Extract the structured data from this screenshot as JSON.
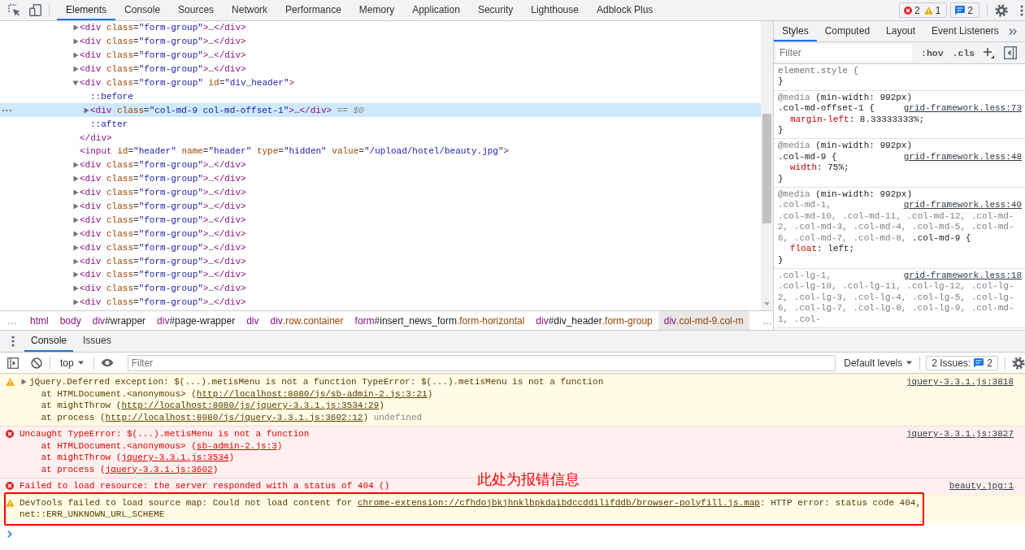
{
  "toolbar": {
    "tabs": [
      {
        "label": "Elements",
        "selected": true
      },
      {
        "label": "Console",
        "selected": false
      },
      {
        "label": "Sources",
        "selected": false
      },
      {
        "label": "Network",
        "selected": false
      },
      {
        "label": "Performance",
        "selected": false
      },
      {
        "label": "Memory",
        "selected": false
      },
      {
        "label": "Application",
        "selected": false
      },
      {
        "label": "Security",
        "selected": false
      },
      {
        "label": "Lighthouse",
        "selected": false
      },
      {
        "label": "Adblock Plus",
        "selected": false
      }
    ],
    "error_count": "2",
    "warning_count": "1",
    "message_count": "2"
  },
  "elements": {
    "dom_tree": [
      {
        "kind": "element",
        "expanded": false,
        "selected": false,
        "tokens": [
          {
            "kind": "tag",
            "text": "<div"
          },
          {
            "kind": "attr-name",
            "text": " class"
          },
          {
            "kind": "punct",
            "text": "="
          },
          {
            "kind": "attr-value",
            "text": "\"form-group\""
          },
          {
            "kind": "tag",
            "text": ">"
          },
          {
            "kind": "plain",
            "text": "…"
          },
          {
            "kind": "tag",
            "text": "</div>"
          }
        ]
      },
      {
        "kind": "element",
        "expanded": false,
        "selected": false,
        "tokens": [
          {
            "kind": "tag",
            "text": "<div"
          },
          {
            "kind": "attr-name",
            "text": " class"
          },
          {
            "kind": "punct",
            "text": "="
          },
          {
            "kind": "attr-value",
            "text": "\"form-group\""
          },
          {
            "kind": "tag",
            "text": ">"
          },
          {
            "kind": "plain",
            "text": "…"
          },
          {
            "kind": "tag",
            "text": "</div>"
          }
        ]
      },
      {
        "kind": "element",
        "expanded": false,
        "selected": false,
        "tokens": [
          {
            "kind": "tag",
            "text": "<div"
          },
          {
            "kind": "attr-name",
            "text": " class"
          },
          {
            "kind": "punct",
            "text": "="
          },
          {
            "kind": "attr-value",
            "text": "\"form-group\""
          },
          {
            "kind": "tag",
            "text": ">"
          },
          {
            "kind": "plain",
            "text": "…"
          },
          {
            "kind": "tag",
            "text": "</div>"
          }
        ]
      },
      {
        "kind": "element",
        "expanded": false,
        "selected": false,
        "tokens": [
          {
            "kind": "tag",
            "text": "<div"
          },
          {
            "kind": "attr-name",
            "text": " class"
          },
          {
            "kind": "punct",
            "text": "="
          },
          {
            "kind": "attr-value",
            "text": "\"form-group\""
          },
          {
            "kind": "tag",
            "text": ">"
          },
          {
            "kind": "plain",
            "text": "…"
          },
          {
            "kind": "tag",
            "text": "</div>"
          }
        ]
      },
      {
        "kind": "element",
        "expanded": true,
        "selected": false,
        "tokens": [
          {
            "kind": "tag",
            "text": "<div"
          },
          {
            "kind": "attr-name",
            "text": " class"
          },
          {
            "kind": "punct",
            "text": "="
          },
          {
            "kind": "attr-value",
            "text": "\"form-group\""
          },
          {
            "kind": "attr-name",
            "text": " id"
          },
          {
            "kind": "punct",
            "text": "="
          },
          {
            "kind": "attr-value",
            "text": "\"div_header\""
          },
          {
            "kind": "tag",
            "text": ">"
          }
        ],
        "children": [
          {
            "kind": "pseudo",
            "selected": false,
            "tokens": [
              {
                "kind": "pseudo",
                "text": "::before"
              }
            ]
          },
          {
            "kind": "element",
            "expanded": false,
            "selected": true,
            "tokens": [
              {
                "kind": "tag",
                "text": "<div"
              },
              {
                "kind": "attr-name",
                "text": " class"
              },
              {
                "kind": "punct",
                "text": "="
              },
              {
                "kind": "attr-value",
                "text": "\"col-md-9 col-md-offset-1\""
              },
              {
                "kind": "tag",
                "text": ">"
              },
              {
                "kind": "plain",
                "text": "…"
              },
              {
                "kind": "tag",
                "text": "</div>"
              },
              {
                "kind": "hint",
                "text": " == $0"
              }
            ]
          },
          {
            "kind": "pseudo",
            "selected": false,
            "tokens": [
              {
                "kind": "pseudo",
                "text": "::after"
              }
            ]
          }
        ],
        "closing_tokens": [
          {
            "kind": "tag",
            "text": "</div>"
          }
        ]
      },
      {
        "kind": "void",
        "selected": false,
        "tokens": [
          {
            "kind": "tag",
            "text": "<input"
          },
          {
            "kind": "attr-name",
            "text": " id"
          },
          {
            "kind": "punct",
            "text": "="
          },
          {
            "kind": "attr-value",
            "text": "\"header\""
          },
          {
            "kind": "attr-name",
            "text": " name"
          },
          {
            "kind": "punct",
            "text": "="
          },
          {
            "kind": "attr-value",
            "text": "\"header\""
          },
          {
            "kind": "attr-name",
            "text": " type"
          },
          {
            "kind": "punct",
            "text": "="
          },
          {
            "kind": "attr-value",
            "text": "\"hidden\""
          },
          {
            "kind": "attr-name",
            "text": " value"
          },
          {
            "kind": "punct",
            "text": "="
          },
          {
            "kind": "attr-value",
            "text": "\"/upload/hotel/beauty.jpg\""
          },
          {
            "kind": "tag",
            "text": ">"
          }
        ]
      },
      {
        "kind": "element",
        "expanded": false,
        "selected": false,
        "tokens": [
          {
            "kind": "tag",
            "text": "<div"
          },
          {
            "kind": "attr-name",
            "text": " class"
          },
          {
            "kind": "punct",
            "text": "="
          },
          {
            "kind": "attr-value",
            "text": "\"form-group\""
          },
          {
            "kind": "tag",
            "text": ">"
          },
          {
            "kind": "plain",
            "text": "…"
          },
          {
            "kind": "tag",
            "text": "</div>"
          }
        ]
      },
      {
        "kind": "element",
        "expanded": false,
        "selected": false,
        "tokens": [
          {
            "kind": "tag",
            "text": "<div"
          },
          {
            "kind": "attr-name",
            "text": " class"
          },
          {
            "kind": "punct",
            "text": "="
          },
          {
            "kind": "attr-value",
            "text": "\"form-group\""
          },
          {
            "kind": "tag",
            "text": ">"
          },
          {
            "kind": "plain",
            "text": "…"
          },
          {
            "kind": "tag",
            "text": "</div>"
          }
        ]
      },
      {
        "kind": "element",
        "expanded": false,
        "selected": false,
        "tokens": [
          {
            "kind": "tag",
            "text": "<div"
          },
          {
            "kind": "attr-name",
            "text": " class"
          },
          {
            "kind": "punct",
            "text": "="
          },
          {
            "kind": "attr-value",
            "text": "\"form-group\""
          },
          {
            "kind": "tag",
            "text": ">"
          },
          {
            "kind": "plain",
            "text": "…"
          },
          {
            "kind": "tag",
            "text": "</div>"
          }
        ]
      },
      {
        "kind": "element",
        "expanded": false,
        "selected": false,
        "tokens": [
          {
            "kind": "tag",
            "text": "<div"
          },
          {
            "kind": "attr-name",
            "text": " class"
          },
          {
            "kind": "punct",
            "text": "="
          },
          {
            "kind": "attr-value",
            "text": "\"form-group\""
          },
          {
            "kind": "tag",
            "text": ">"
          },
          {
            "kind": "plain",
            "text": "…"
          },
          {
            "kind": "tag",
            "text": "</div>"
          }
        ]
      },
      {
        "kind": "element",
        "expanded": false,
        "selected": false,
        "tokens": [
          {
            "kind": "tag",
            "text": "<div"
          },
          {
            "kind": "attr-name",
            "text": " class"
          },
          {
            "kind": "punct",
            "text": "="
          },
          {
            "kind": "attr-value",
            "text": "\"form-group\""
          },
          {
            "kind": "tag",
            "text": ">"
          },
          {
            "kind": "plain",
            "text": "…"
          },
          {
            "kind": "tag",
            "text": "</div>"
          }
        ]
      },
      {
        "kind": "element",
        "expanded": false,
        "selected": false,
        "tokens": [
          {
            "kind": "tag",
            "text": "<div"
          },
          {
            "kind": "attr-name",
            "text": " class"
          },
          {
            "kind": "punct",
            "text": "="
          },
          {
            "kind": "attr-value",
            "text": "\"form-group\""
          },
          {
            "kind": "tag",
            "text": ">"
          },
          {
            "kind": "plain",
            "text": "…"
          },
          {
            "kind": "tag",
            "text": "</div>"
          }
        ]
      },
      {
        "kind": "element",
        "expanded": false,
        "selected": false,
        "tokens": [
          {
            "kind": "tag",
            "text": "<div"
          },
          {
            "kind": "attr-name",
            "text": " class"
          },
          {
            "kind": "punct",
            "text": "="
          },
          {
            "kind": "attr-value",
            "text": "\"form-group\""
          },
          {
            "kind": "tag",
            "text": ">"
          },
          {
            "kind": "plain",
            "text": "…"
          },
          {
            "kind": "tag",
            "text": "</div>"
          }
        ]
      },
      {
        "kind": "element",
        "expanded": false,
        "selected": false,
        "tokens": [
          {
            "kind": "tag",
            "text": "<div"
          },
          {
            "kind": "attr-name",
            "text": " class"
          },
          {
            "kind": "punct",
            "text": "="
          },
          {
            "kind": "attr-value",
            "text": "\"form-group\""
          },
          {
            "kind": "tag",
            "text": ">"
          },
          {
            "kind": "plain",
            "text": "…"
          },
          {
            "kind": "tag",
            "text": "</div>"
          }
        ]
      },
      {
        "kind": "element",
        "expanded": false,
        "selected": false,
        "tokens": [
          {
            "kind": "tag",
            "text": "<div"
          },
          {
            "kind": "attr-name",
            "text": " class"
          },
          {
            "kind": "punct",
            "text": "="
          },
          {
            "kind": "attr-value",
            "text": "\"form-group\""
          },
          {
            "kind": "tag",
            "text": ">"
          },
          {
            "kind": "plain",
            "text": "…"
          },
          {
            "kind": "tag",
            "text": "</div>"
          }
        ]
      },
      {
        "kind": "element",
        "expanded": false,
        "selected": false,
        "tokens": [
          {
            "kind": "tag",
            "text": "<div"
          },
          {
            "kind": "attr-name",
            "text": " class"
          },
          {
            "kind": "punct",
            "text": "="
          },
          {
            "kind": "attr-value",
            "text": "\"form-group\""
          },
          {
            "kind": "tag",
            "text": ">"
          },
          {
            "kind": "plain",
            "text": "…"
          },
          {
            "kind": "tag",
            "text": "</div>"
          }
        ]
      },
      {
        "kind": "element",
        "expanded": false,
        "selected": false,
        "tokens": [
          {
            "kind": "tag",
            "text": "<div"
          },
          {
            "kind": "attr-name",
            "text": " class"
          },
          {
            "kind": "punct",
            "text": "="
          },
          {
            "kind": "attr-value",
            "text": "\"form-group\""
          },
          {
            "kind": "tag",
            "text": ">"
          },
          {
            "kind": "plain",
            "text": "…"
          },
          {
            "kind": "tag",
            "text": "</div>"
          }
        ]
      }
    ],
    "breadcrumbs": {
      "scroll_left": "…",
      "items": [
        {
          "selected": false,
          "parts": [
            {
              "kind": "name",
              "text": "html"
            }
          ]
        },
        {
          "selected": false,
          "parts": [
            {
              "kind": "name",
              "text": "body"
            }
          ]
        },
        {
          "selected": false,
          "parts": [
            {
              "kind": "name",
              "text": "div"
            },
            {
              "kind": "id",
              "text": "#wrapper"
            }
          ]
        },
        {
          "selected": false,
          "parts": [
            {
              "kind": "name",
              "text": "div"
            },
            {
              "kind": "id",
              "text": "#page-wrapper"
            }
          ]
        },
        {
          "selected": false,
          "parts": [
            {
              "kind": "name",
              "text": "div"
            }
          ]
        },
        {
          "selected": false,
          "parts": [
            {
              "kind": "name",
              "text": "div"
            },
            {
              "kind": "class",
              "text": ".row.container"
            }
          ]
        },
        {
          "selected": false,
          "parts": [
            {
              "kind": "name",
              "text": "form"
            },
            {
              "kind": "id",
              "text": "#insert_news_form"
            },
            {
              "kind": "class",
              "text": ".form-horizontal"
            }
          ]
        },
        {
          "selected": false,
          "parts": [
            {
              "kind": "name",
              "text": "div"
            },
            {
              "kind": "id",
              "text": "#div_header"
            },
            {
              "kind": "class",
              "text": ".form-group"
            }
          ]
        },
        {
          "selected": true,
          "parts": [
            {
              "kind": "name",
              "text": "div"
            },
            {
              "kind": "class",
              "text": ".col-md-9.col-m"
            }
          ]
        }
      ],
      "scroll_right": "…"
    }
  },
  "styles": {
    "tabs": [
      {
        "label": "Styles",
        "selected": true
      },
      {
        "label": "Computed",
        "selected": false
      },
      {
        "label": "Layout",
        "selected": false
      },
      {
        "label": "Event Listeners",
        "selected": false
      }
    ],
    "filter": {
      "placeholder": "Filter"
    },
    "toggles": [
      ":hov",
      ".cls"
    ],
    "rules": [
      {
        "kind": "inline",
        "selectors": [
          {
            "text": "element.style"
          }
        ],
        "open": "{",
        "close": "}"
      },
      {
        "kind": "author",
        "media": {
          "keyword": "@media",
          "query": "(min-width: 992px)"
        },
        "selectors": [
          {
            "text": ".col-md-offset-1",
            "matched": true
          }
        ],
        "open": "{",
        "source": "grid-framework.less:73",
        "declarations": [
          {
            "property": "margin-left",
            "value": ": 8.33333333%;"
          }
        ],
        "close": "}"
      },
      {
        "kind": "author",
        "media": {
          "keyword": "@media",
          "query": "(min-width: 992px)"
        },
        "selectors": [
          {
            "text": ".col-md-9",
            "matched": true
          }
        ],
        "open": "{",
        "source": "grid-framework.less:48",
        "declarations": [
          {
            "property": "width",
            "value": ": 75%;"
          }
        ],
        "close": "}"
      },
      {
        "kind": "author",
        "media": {
          "keyword": "@media",
          "query": "(min-width: 992px)"
        },
        "selectors": [
          {
            "text": ".col-md-1,",
            "matched": false
          },
          {
            "text": ".col-md-10,",
            "matched": false
          },
          {
            "text": ".col-md-11,",
            "matched": false
          },
          {
            "text": ".col-md-12,",
            "matched": false
          },
          {
            "text": ".col-md-2,",
            "matched": false
          },
          {
            "text": ".col-md-3,",
            "matched": false
          },
          {
            "text": ".col-md-4,",
            "matched": false
          },
          {
            "text": ".col-md-5,",
            "matched": false
          },
          {
            "text": ".col-md-6,",
            "matched": false
          },
          {
            "text": ".col-md-7,",
            "matched": false
          },
          {
            "text": ".col-md-8,",
            "matched": false
          },
          {
            "text": ".col-md-9",
            "matched": true
          }
        ],
        "open": "{",
        "source": "grid-framework.less:40",
        "declarations": [
          {
            "property": "float",
            "value": ": left;"
          }
        ],
        "close": "}"
      },
      {
        "kind": "author",
        "selectors": [
          {
            "text": ".col-lg-1,",
            "matched": false
          },
          {
            "text": ".col-lg-10,",
            "matched": false
          },
          {
            "text": ".col-lg-11,",
            "matched": false
          },
          {
            "text": ".col-lg-12,",
            "matched": false
          },
          {
            "text": ".col-lg-2,",
            "matched": false
          },
          {
            "text": ".col-lg-3,",
            "matched": false
          },
          {
            "text": ".col-lg-4,",
            "matched": false
          },
          {
            "text": ".col-lg-5,",
            "matched": false
          },
          {
            "text": ".col-lg-6,",
            "matched": false
          },
          {
            "text": ".col-lg-7,",
            "matched": false
          },
          {
            "text": ".col-lg-8,",
            "matched": false
          },
          {
            "text": ".col-lg-9,",
            "matched": false
          },
          {
            "text": ".col-md-1,",
            "matched": false
          },
          {
            "text": ".col-",
            "matched": false
          }
        ],
        "source": "grid-framework.less:18"
      }
    ]
  },
  "drawer": {
    "tabs": [
      {
        "label": "Console",
        "selected": true
      },
      {
        "label": "Issues",
        "selected": false
      }
    ],
    "context": "top",
    "filter": {
      "placeholder": "Filter"
    },
    "levels": "Default levels",
    "issues_button": {
      "label": "2 Issues:",
      "count": "2"
    },
    "messages": [
      {
        "kind": "warning",
        "expanded": false,
        "highlighted": false,
        "source": "jquery-3.3.1.js:3818",
        "lines": [
          {
            "kind": "head",
            "segments": [
              {
                "kind": "plain",
                "text": "jQuery.Deferred exception: $(...).metisMenu is not a function TypeError: $(...).metisMenu is not a function"
              }
            ]
          },
          {
            "kind": "stack",
            "segments": [
              {
                "kind": "plain",
                "text": "at HTMLDocument.<anonymous> ("
              },
              {
                "kind": "link",
                "text": "http://localhost:8080/js/sb-admin-2.js:3:21"
              },
              {
                "kind": "plain",
                "text": ")"
              }
            ]
          },
          {
            "kind": "stack",
            "segments": [
              {
                "kind": "plain",
                "text": "at mightThrow ("
              },
              {
                "kind": "link",
                "text": "http://localhost:8080/js/jquery-3.3.1.js:3534:29"
              },
              {
                "kind": "plain",
                "text": ")"
              }
            ]
          },
          {
            "kind": "stack",
            "segments": [
              {
                "kind": "plain",
                "text": "at process ("
              },
              {
                "kind": "link",
                "text": "http://localhost:8080/js/jquery-3.3.1.js:3602:12"
              },
              {
                "kind": "plain",
                "text": ") "
              },
              {
                "kind": "muted",
                "text": "undefined"
              }
            ]
          }
        ]
      },
      {
        "kind": "error",
        "highlighted": false,
        "source": "jquery-3.3.1.js:3827",
        "lines": [
          {
            "kind": "head",
            "segments": [
              {
                "kind": "plain",
                "text": "Uncaught TypeError: $(...).metisMenu is not a function"
              }
            ]
          },
          {
            "kind": "stack",
            "segments": [
              {
                "kind": "plain",
                "text": "at HTMLDocument.<anonymous> ("
              },
              {
                "kind": "link",
                "text": "sb-admin-2.js:3"
              },
              {
                "kind": "plain",
                "text": ")"
              }
            ]
          },
          {
            "kind": "stack",
            "segments": [
              {
                "kind": "plain",
                "text": "at mightThrow ("
              },
              {
                "kind": "link",
                "text": "jquery-3.3.1.js:3534"
              },
              {
                "kind": "plain",
                "text": ")"
              }
            ]
          },
          {
            "kind": "stack",
            "segments": [
              {
                "kind": "plain",
                "text": "at process ("
              },
              {
                "kind": "link",
                "text": "jquery-3.3.1.js:3602"
              },
              {
                "kind": "plain",
                "text": ")"
              }
            ]
          }
        ]
      },
      {
        "kind": "error",
        "highlighted": false,
        "source": "beauty.jpg:1",
        "lines": [
          {
            "kind": "head",
            "segments": [
              {
                "kind": "plain",
                "text": "Failed to load resource: the server responded with a status of 404 ()"
              }
            ]
          }
        ]
      },
      {
        "kind": "warning",
        "highlighted": true,
        "lines": [
          {
            "kind": "head",
            "segments": [
              {
                "kind": "plain",
                "text": "DevTools failed to load source map: Could not load content for "
              },
              {
                "kind": "link",
                "text": "chrome-extension://cfhdojbkjhnklbpkdaibdccddilifddb/browser-polyfill.js.map"
              },
              {
                "kind": "plain",
                "text": ": HTTP error: status code 404, net::ERR_UNKNOWN_URL_SCHEME"
              }
            ]
          }
        ]
      }
    ]
  },
  "annotation": {
    "text": "此处为报错信息"
  }
}
